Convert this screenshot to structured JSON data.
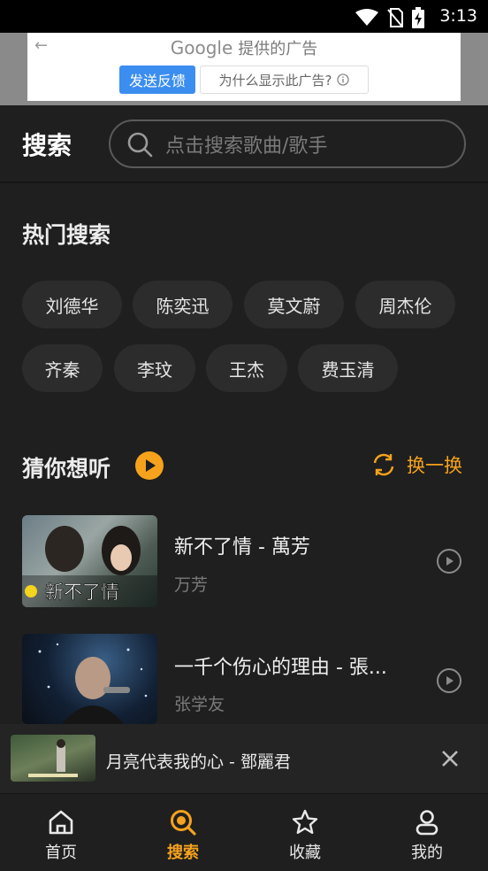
{
  "status": {
    "time": "3:13"
  },
  "ad": {
    "brand": "Google",
    "caption": "提供的广告",
    "feedback_label": "发送反馈",
    "why_label": "为什么显示此广告?"
  },
  "header": {
    "title": "搜索",
    "search_placeholder": "点击搜索歌曲/歌手"
  },
  "hot": {
    "title": "热门搜索",
    "tags": [
      "刘德华",
      "陈奕迅",
      "莫文蔚",
      "周杰伦",
      "齐秦",
      "李玟",
      "王杰",
      "费玉清"
    ]
  },
  "guess": {
    "title": "猜你想听",
    "refresh_label": "换一换",
    "songs": [
      {
        "title": "新不了情 - 萬芳",
        "artist": "万芳",
        "thumb_caption": "新不了情"
      },
      {
        "title": "一千个伤心的理由 - 張...",
        "artist": "张学友"
      }
    ]
  },
  "player": {
    "title": "月亮代表我的心 - 鄧麗君"
  },
  "tabs": [
    {
      "label": "首页",
      "icon": "home-icon",
      "active": false
    },
    {
      "label": "搜索",
      "icon": "search-icon",
      "active": true
    },
    {
      "label": "收藏",
      "icon": "star-icon",
      "active": false
    },
    {
      "label": "我的",
      "icon": "user-icon",
      "active": false
    }
  ],
  "colors": {
    "accent": "#f6a21c",
    "background": "#1f1f1f",
    "tag_bg": "#2c2c2c"
  }
}
